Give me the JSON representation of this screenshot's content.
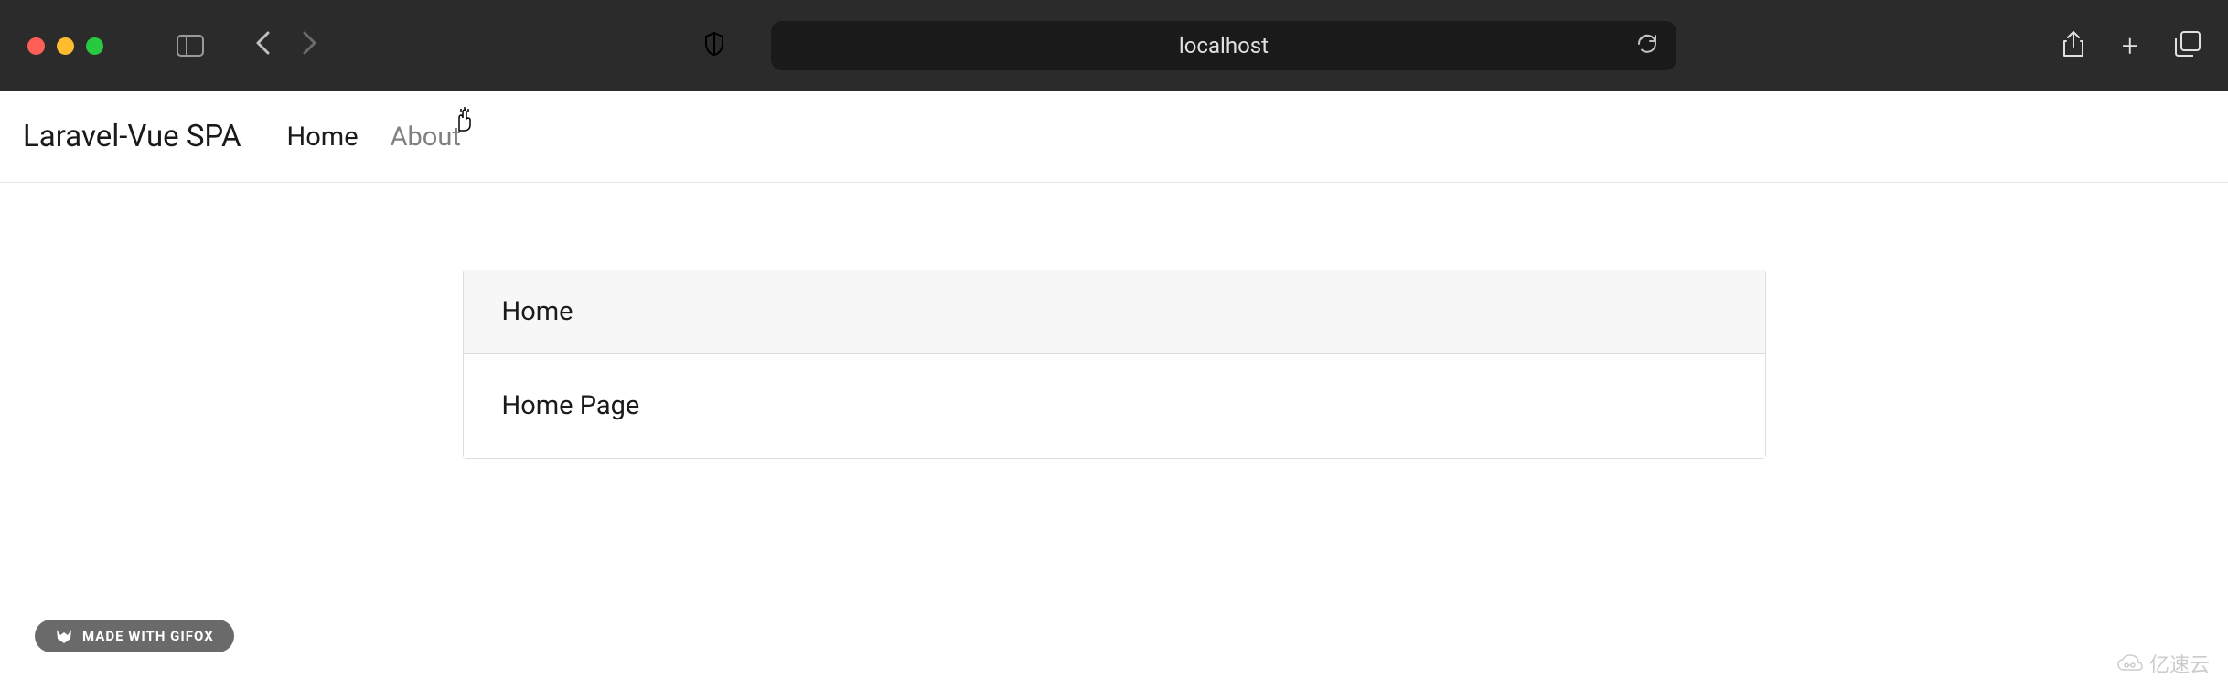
{
  "browser": {
    "url": "localhost"
  },
  "navbar": {
    "brand": "Laravel-Vue SPA",
    "links": [
      {
        "label": "Home",
        "active": true
      },
      {
        "label": "About",
        "active": false
      }
    ]
  },
  "card": {
    "title": "Home",
    "body": "Home Page"
  },
  "badge": {
    "text": "MADE WITH GIFOX"
  },
  "watermark": {
    "text": "亿速云"
  }
}
